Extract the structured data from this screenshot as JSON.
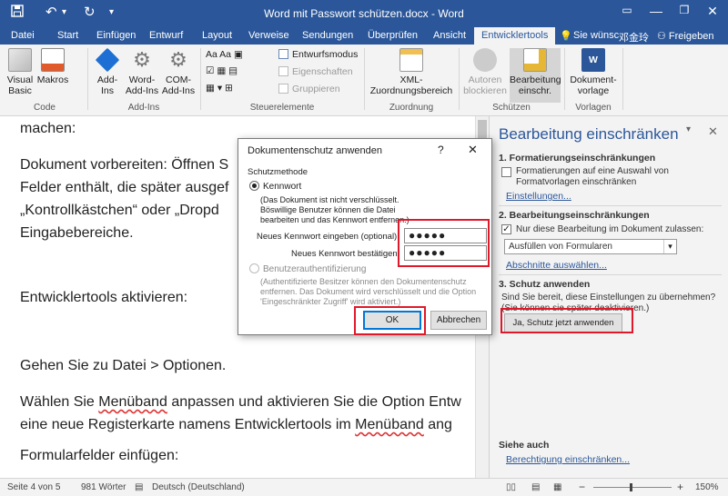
{
  "window": {
    "title": "Word mit Passwort schützen.docx - Word",
    "minimize": "—",
    "restore": "❐",
    "close": "✕",
    "ribbon_display": "▭"
  },
  "quick_access": {
    "save_icon": "save-icon",
    "undo": "↶",
    "undo_dropdown": "▾",
    "redo": "↻",
    "customize": "▾"
  },
  "tabs": [
    "Datei",
    "Start",
    "Einfügen",
    "Entwurf",
    "Layout",
    "Verweise",
    "Sendungen",
    "Überprüfen",
    "Ansicht",
    "Entwicklertools"
  ],
  "active_tab": "Entwicklertools",
  "tell_me": "Sie wünsc",
  "user": "邓金玲",
  "share": "Freigeben",
  "ribbon": {
    "code": {
      "label": "Code",
      "visual_basic": "Visual Basic",
      "makros": "Makros"
    },
    "addins": {
      "label": "Add-Ins",
      "addins": "Add-Ins",
      "word_addins": "Word-Add-Ins",
      "com_addins": "COM-Add-Ins"
    },
    "controls": {
      "label": "Steuerelemente",
      "design_mode": "Entwurfsmodus",
      "properties": "Eigenschaften",
      "group": "Gruppieren"
    },
    "mapping": {
      "label": "Zuordnung",
      "xml": "XML-Zuordnungsbereich"
    },
    "protect": {
      "label": "Schützen",
      "block_authors": "Autoren blockieren",
      "restrict_editing": "Bearbeitung einschr."
    },
    "templates": {
      "label": "Vorlagen",
      "doc_template": "Dokument-vorlage"
    }
  },
  "document": {
    "lines": [
      "machen:",
      "Dokument vorbereiten: Öffnen S",
      "Felder enthält, die später ausgef",
      "„Kontrollkästchen“ oder „Dropd",
      "Eingabebereiche.",
      "Entwicklertools aktivieren:",
      "Gehen Sie zu Datei > Optionen.",
      "Wählen Sie ",
      "Menüband",
      " anpassen und aktivieren Sie die Option Entw",
      "eine neue Registerkarte namens Entwicklertools im ",
      "Menüband",
      " ang",
      "Formularfelder einfügen:"
    ]
  },
  "pane": {
    "title": "Bearbeitung einschränken",
    "close": "✕",
    "dropdown": "▾",
    "s1_title": "1. Formatierungseinschränkungen",
    "s1_checkbox": "Formatierungen auf eine Auswahl von Formatvorlagen einschränken",
    "s1_link": "Einstellungen...",
    "s2_title": "2. Bearbeitungseinschränkungen",
    "s2_checkbox": "Nur diese Bearbeitung im Dokument zulassen:",
    "s2_select": "Ausfüllen von Formularen",
    "s2_link": "Abschnitte auswählen...",
    "s3_title": "3. Schutz anwenden",
    "s3_text": "Sind Sie bereit, diese Einstellungen zu übernehmen? (Sie können sie später deaktivieren.)",
    "s3_button": "Ja, Schutz jetzt anwenden",
    "see_also": "Siehe auch",
    "see_also_link": "Berechtigung einschränken..."
  },
  "dialog": {
    "title": "Dokumentenschutz anwenden",
    "help": "?",
    "close": "✕",
    "method_label": "Schutzmethode",
    "password_radio": "Kennwort",
    "password_note": "(Das Dokument ist nicht verschlüsselt. Böswillige Benutzer können die Datei bearbeiten und das Kennwort entfernen.)",
    "enter_label": "Neues Kennwort eingeben (optional):",
    "confirm_label": "Neues Kennwort bestätigen:",
    "password_value": "●●●●●",
    "confirm_value": "●●●●●",
    "auth_radio": "Benutzerauthentifizierung",
    "auth_note": "(Authentifizierte Besitzer können den Dokumentenschutz entfernen. Das Dokument wird verschlüsselt und die Option 'Eingeschränkter Zugriff' wird aktiviert.)",
    "ok": "OK",
    "cancel": "Abbrechen"
  },
  "status": {
    "page": "Seite 4 von 5",
    "words": "981 Wörter",
    "language": "Deutsch (Deutschland)",
    "zoom_minus": "−",
    "zoom_plus": "+",
    "zoom": "150%"
  },
  "colors": {
    "accent": "#2b579a",
    "highlight": "#e0192a"
  }
}
